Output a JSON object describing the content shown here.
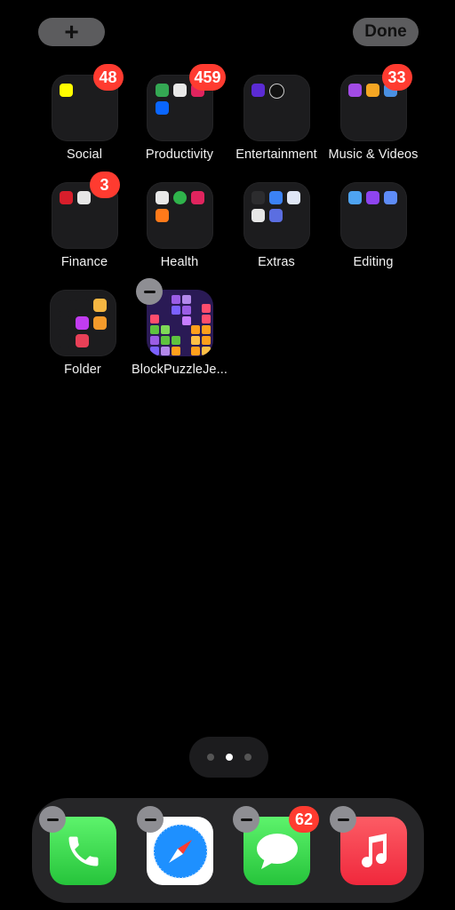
{
  "header": {
    "add_label": "+",
    "done_label": "Done"
  },
  "folders": [
    {
      "label": "Social",
      "badge": "48"
    },
    {
      "label": "Productivity",
      "badge": "459"
    },
    {
      "label": "Entertainment",
      "badge": ""
    },
    {
      "label": "Music & Videos",
      "badge": "33"
    },
    {
      "label": "Finance",
      "badge": "3"
    },
    {
      "label": "Health",
      "badge": ""
    },
    {
      "label": "Extras",
      "badge": ""
    },
    {
      "label": "Editing",
      "badge": ""
    },
    {
      "label": "Folder",
      "badge": ""
    }
  ],
  "apps": [
    {
      "label": "BlockPuzzleJe..."
    }
  ],
  "page_indicator": {
    "total": 3,
    "active": 2
  },
  "dock": [
    {
      "name": "Phone",
      "icon": "phone-icon",
      "badge": ""
    },
    {
      "name": "Safari",
      "icon": "compass-icon",
      "badge": ""
    },
    {
      "name": "Messages",
      "icon": "speech-bubble-icon",
      "badge": "62"
    },
    {
      "name": "Music",
      "icon": "music-note-icon",
      "badge": ""
    }
  ],
  "colors": {
    "badge": "#ff3b30",
    "folder": "#1c1c1e",
    "dock": "#262628"
  }
}
